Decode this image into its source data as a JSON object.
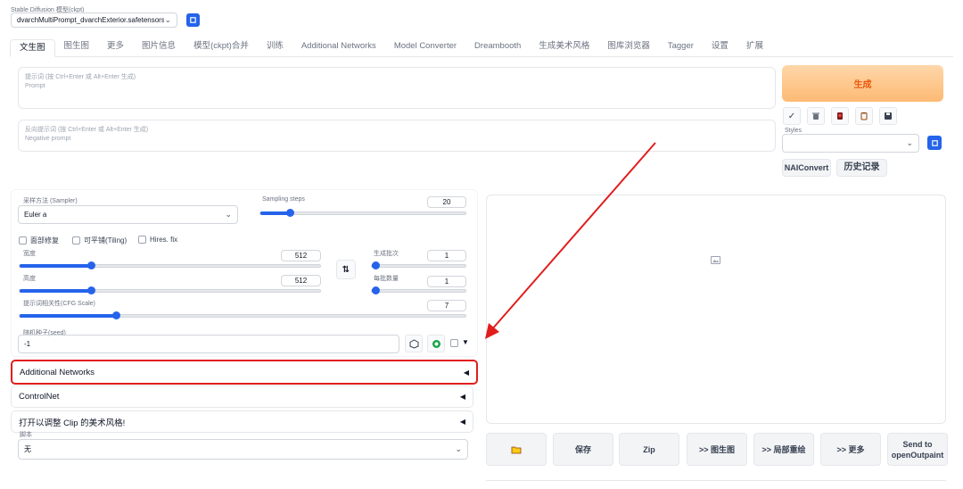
{
  "model": {
    "label": "Stable Diffusion 模型(ckpt)",
    "value": "dvarchMultiPrompt_dvarchExterior.safetensors [",
    "chevron_icon": "chevron-down-icon",
    "refresh_icon": "refresh-icon"
  },
  "tabs": [
    {
      "label": "文生图",
      "active": true
    },
    {
      "label": "图生图"
    },
    {
      "label": "更多"
    },
    {
      "label": "图片信息"
    },
    {
      "label": "模型(ckpt)合并"
    },
    {
      "label": "训练"
    },
    {
      "label": "Additional Networks"
    },
    {
      "label": "Model Converter"
    },
    {
      "label": "Dreambooth"
    },
    {
      "label": "生成美术风格"
    },
    {
      "label": "图库浏览器"
    },
    {
      "label": "Tagger"
    },
    {
      "label": "设置"
    },
    {
      "label": "扩展"
    }
  ],
  "prompt": {
    "placeholder_line1": "提示词 (按 Ctrl+Enter 或 Alt+Enter 生成)",
    "placeholder_line2": "Prompt"
  },
  "negative_prompt": {
    "placeholder_line1": "反向提示词 (按 Ctrl+Enter 或 Alt+Enter 生成)",
    "placeholder_line2": "Negative prompt"
  },
  "generate": {
    "label": "生成",
    "color": "#fb923c"
  },
  "tools": [
    "check-icon",
    "trash-icon",
    "red-card-icon",
    "clipboard-icon",
    "save-icon"
  ],
  "styles": {
    "label": "Styles",
    "value": ""
  },
  "nai_convert": "NAIConvert",
  "history": "历史记录",
  "sampler": {
    "label": "采样方法 (Sampler)",
    "value": "Euler a"
  },
  "steps": {
    "label": "Sampling steps",
    "value": "20",
    "fraction": 0.13
  },
  "checkboxes": {
    "face_restore": "面部修复",
    "tiling": "可平铺(Tiling)",
    "hires": "Hires. fix"
  },
  "width": {
    "label": "宽度",
    "value": "512",
    "fraction": 0.23
  },
  "height": {
    "label": "高度",
    "value": "512",
    "fraction": 0.23
  },
  "batch_count": {
    "label": "生成批次",
    "value": "1",
    "fraction": 0.0
  },
  "batch_size": {
    "label": "每批数量",
    "value": "1",
    "fraction": 0.0
  },
  "swap_icon": "swap-vertical-icon",
  "cfg": {
    "label": "提示词相关性(CFG Scale)",
    "value": "7",
    "fraction": 0.21
  },
  "seed": {
    "label": "随机种子(seed)",
    "value": "-1",
    "dice_icon": "dice-icon",
    "recycle_icon": "recycle-icon"
  },
  "accordions": {
    "additional_networks": "Additional Networks",
    "controlnet": "ControlNet",
    "clip_style": "打开以调整 Clip 的美术风格!"
  },
  "script": {
    "label": "脚本",
    "value": "无"
  },
  "gallery": {
    "image_icon": "image-placeholder-icon"
  },
  "output_buttons": {
    "folder_icon": "folder-icon",
    "save": "保存",
    "zip": "Zip",
    "to_img2img": ">> 图生图",
    "to_inpaint": ">> 局部重绘",
    "to_more": ">> 更多",
    "send_openoutpaint_1": "Send to",
    "send_openoutpaint_2": "openOutpaint"
  },
  "annotation": {
    "highlight_color": "#e11d1d"
  }
}
